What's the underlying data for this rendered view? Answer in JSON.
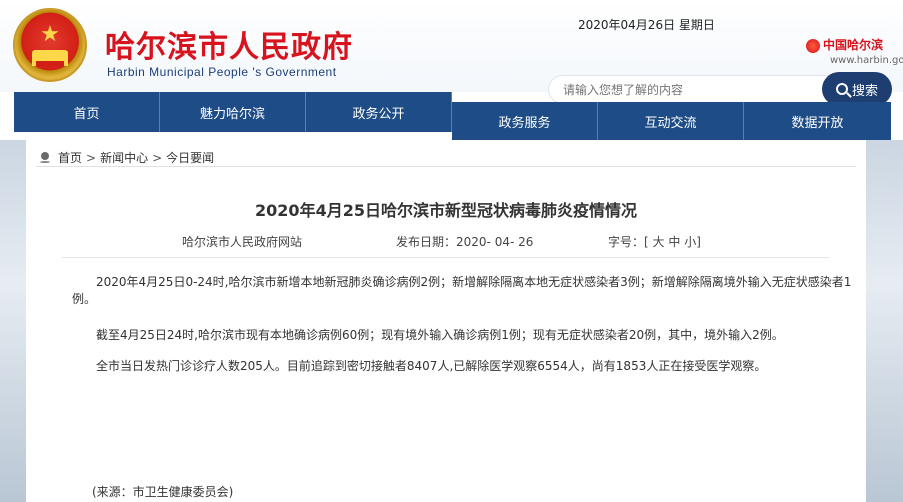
{
  "header": {
    "top_strip": "                :  ",
    "site_title": "哈尔滨市人民政府",
    "site_subtitle": "Harbin Municipal People 's Government",
    "date": "2020年04月26日 星期日",
    "brand_logo": "中国哈尔滨",
    "domain": "www.harbin.gov.cn"
  },
  "search": {
    "placeholder": "请输入您想了解的内容",
    "button_label": "搜索"
  },
  "nav": {
    "items": [
      "首页",
      "魅力哈尔滨",
      "政务公开",
      "政务服务",
      "互动交流",
      "数据开放"
    ]
  },
  "breadcrumb": {
    "items": [
      "首页",
      "新闻中心",
      "今日要闻"
    ],
    "separator": ">"
  },
  "article": {
    "title": "2020年4月25日哈尔滨市新型冠状病毒肺炎疫情情况",
    "meta": {
      "source_site": "哈尔滨市人民政府网站",
      "date_label": "发布日期：",
      "date_value": "2020- 04- 26",
      "font_label": "字号：[",
      "size_large": "大",
      "size_medium": "中",
      "size_small": "小",
      "font_close": "]"
    },
    "paragraphs": [
      "2020年4月25日0-24时,哈尔滨市新增本地新冠肺炎确诊病例2例；新增解除隔离本地无症状感染者3例；新增解除隔离境外输入无症状感染者1例。",
      "截至4月25日24时,哈尔滨市现有本地确诊病例60例；现有境外输入确诊病例1例；现有无症状感染者20例，其中，境外输入2例。",
      "全市当日发热门诊诊疗人数205人。目前追踪到密切接触者8407人,已解除医学观察6554人，尚有1853人正在接受医学观察。"
    ],
    "source_line": "(来源：市卫生健康委员会)"
  },
  "colors": {
    "nav_blue": "#1e4c86",
    "search_blue": "#1e3e72",
    "title_red": "#d7131e"
  }
}
